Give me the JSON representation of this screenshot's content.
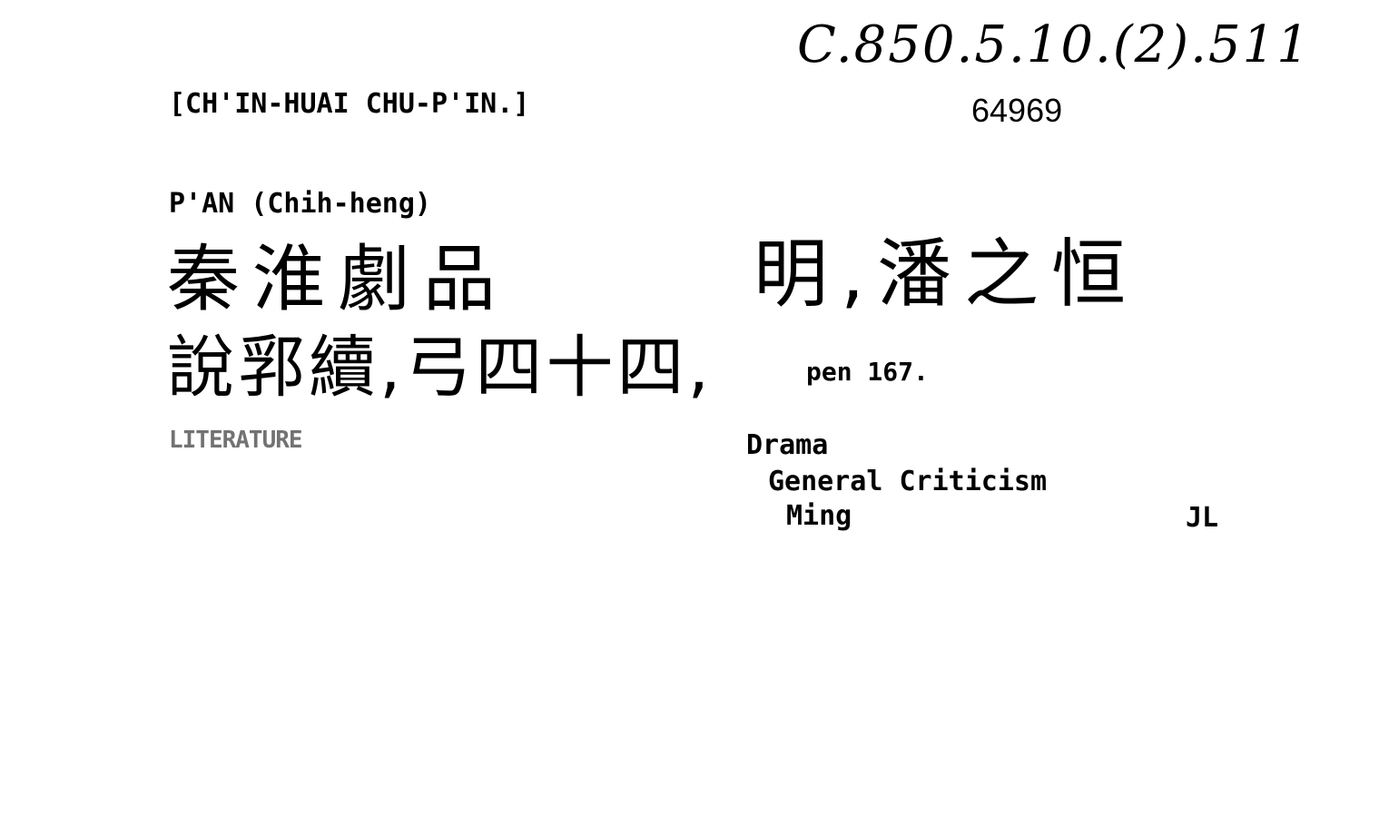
{
  "card": {
    "call_number": "C.850.5.10.(2).511",
    "accession_number": "64969",
    "title_romanized": "[CH'IN-HUAI CHU-P'IN.]",
    "author_romanized": "P'AN (Chih-heng)",
    "title_chinese": "秦淮劇品",
    "author_chinese": "明,潘之恒",
    "series_chinese": "說郛續,弓四十四,",
    "series_page": "pen 167.",
    "subject_main": "LITERATURE",
    "subject_heading": "Drama",
    "subject_sub1": "General Criticism",
    "subject_sub2": "Ming",
    "cataloger_initials": "JL"
  }
}
